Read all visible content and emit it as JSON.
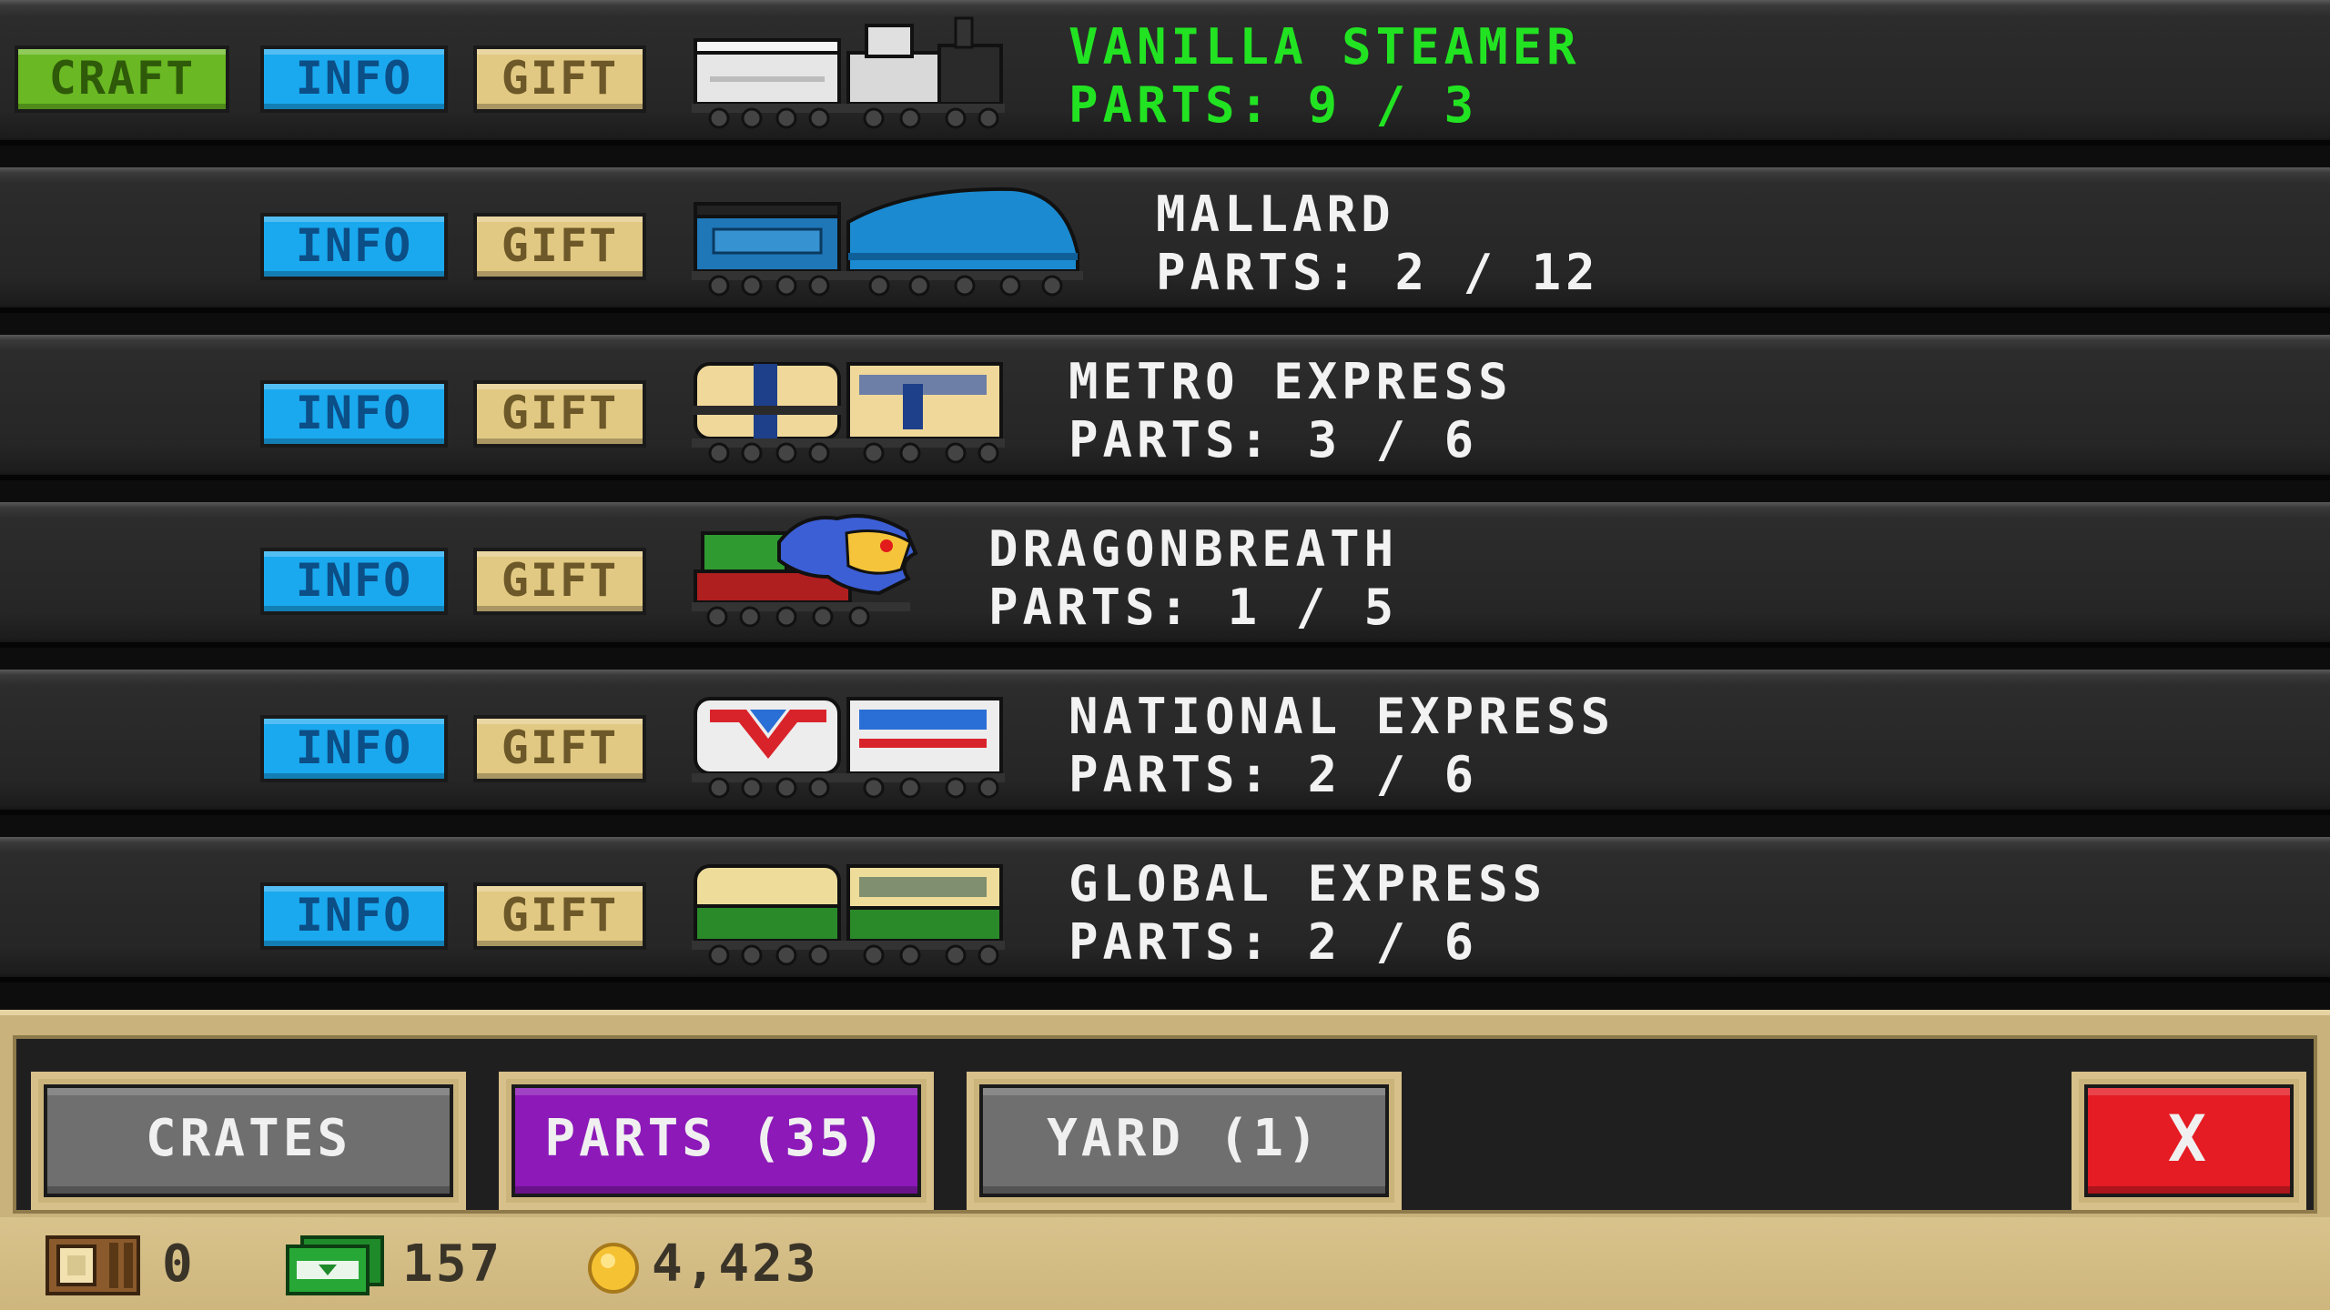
{
  "rows": [
    {
      "name": "VANILLA STEAMER",
      "parts": "PARTS: 9 / 3",
      "craft_label": "CRAFT",
      "info_label": "INFO",
      "gift_label": "GIFT"
    },
    {
      "name": "MALLARD",
      "parts": "PARTS: 2 / 12",
      "info_label": "INFO",
      "gift_label": "GIFT"
    },
    {
      "name": "METRO EXPRESS",
      "parts": "PARTS: 3 / 6",
      "info_label": "INFO",
      "gift_label": "GIFT"
    },
    {
      "name": "DRAGONBREATH",
      "parts": "PARTS: 1 / 5",
      "info_label": "INFO",
      "gift_label": "GIFT"
    },
    {
      "name": "NATIONAL EXPRESS",
      "parts": "PARTS: 2 / 6",
      "info_label": "INFO",
      "gift_label": "GIFT"
    },
    {
      "name": "GLOBAL EXPRESS",
      "parts": "PARTS: 2 / 6",
      "info_label": "INFO",
      "gift_label": "GIFT"
    }
  ],
  "tabs": {
    "crates": "CRATES",
    "parts": "PARTS (35)",
    "yard": "YARD (1)",
    "close": "X"
  },
  "status": {
    "crates_count": "0",
    "cash": "157",
    "coins": "4,423"
  },
  "colors": {
    "craft_green": "#6ab823",
    "info_blue": "#1aa9ef",
    "gift_tan": "#e2c983",
    "active_tab_purple": "#8c19b8",
    "close_red": "#e51c24",
    "craftable_name_green": "#22e322"
  },
  "icons": {
    "crate": "crate-icon",
    "cash": "cash-icon",
    "coin": "coin-icon"
  }
}
